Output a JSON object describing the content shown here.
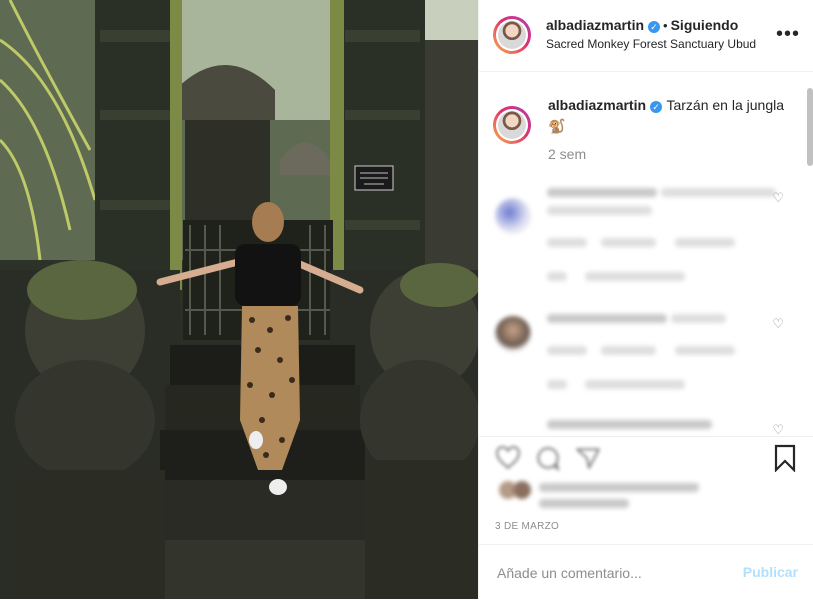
{
  "post": {
    "username": "albadiazmartin",
    "verified": true,
    "follow_status": "Siguiendo",
    "location": "Sacred Monkey Forest Sanctuary Ubud",
    "more_icon": "more-horizontal-icon"
  },
  "caption": {
    "username": "albadiazmartin",
    "text": "Tarzán en la jungla",
    "emoji": "🐒",
    "time_ago": "2 sem"
  },
  "photo": {
    "sign_text": "TEMPLE ENTRANCE\nDO NOT ENTER\nThank you"
  },
  "actions": {
    "icons": [
      "heart-icon",
      "comment-icon",
      "share-icon",
      "bookmark-icon"
    ],
    "date": "3 DE MARZO"
  },
  "add_comment": {
    "placeholder": "Añade un comentario...",
    "publish_label": "Publicar"
  },
  "colors": {
    "accent": "#3897f0",
    "publish_disabled": "#b2dffc",
    "secondary_text": "#8e8e8e"
  }
}
